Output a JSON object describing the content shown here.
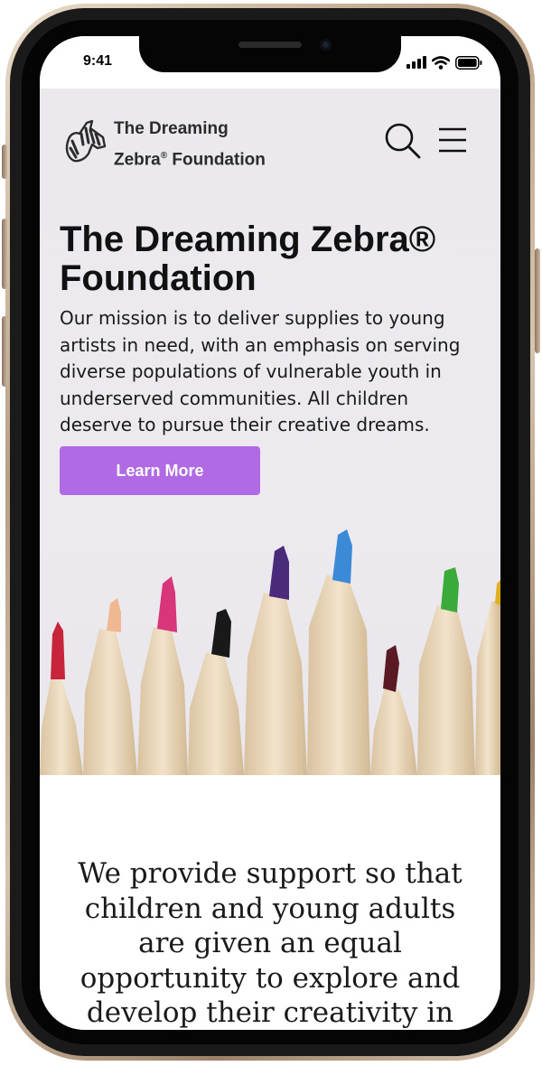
{
  "status_bar": {
    "time": "9:41"
  },
  "header": {
    "logo_line1": "The Dreaming",
    "logo_line2": "Zebra",
    "logo_reg": "®",
    "logo_line2b": " Foundation",
    "logo_icon": "zebra-logo-icon",
    "search_icon": "search-icon",
    "menu_icon": "hamburger-menu-icon"
  },
  "hero": {
    "title": "The Dreaming Zebra® Foundation",
    "text": "Our mission is to deliver supplies to young artists in need, with an emphasis on serving diverse populations of vulnerable youth in underserved communities.  All children deserve to pursue their creative dreams.",
    "button_label": "Learn More",
    "button_color": "#b06be4"
  },
  "content": {
    "support_text": "We provide support so that children and young adults are given an equal opportunity to explore and develop their creativity in the arts."
  }
}
